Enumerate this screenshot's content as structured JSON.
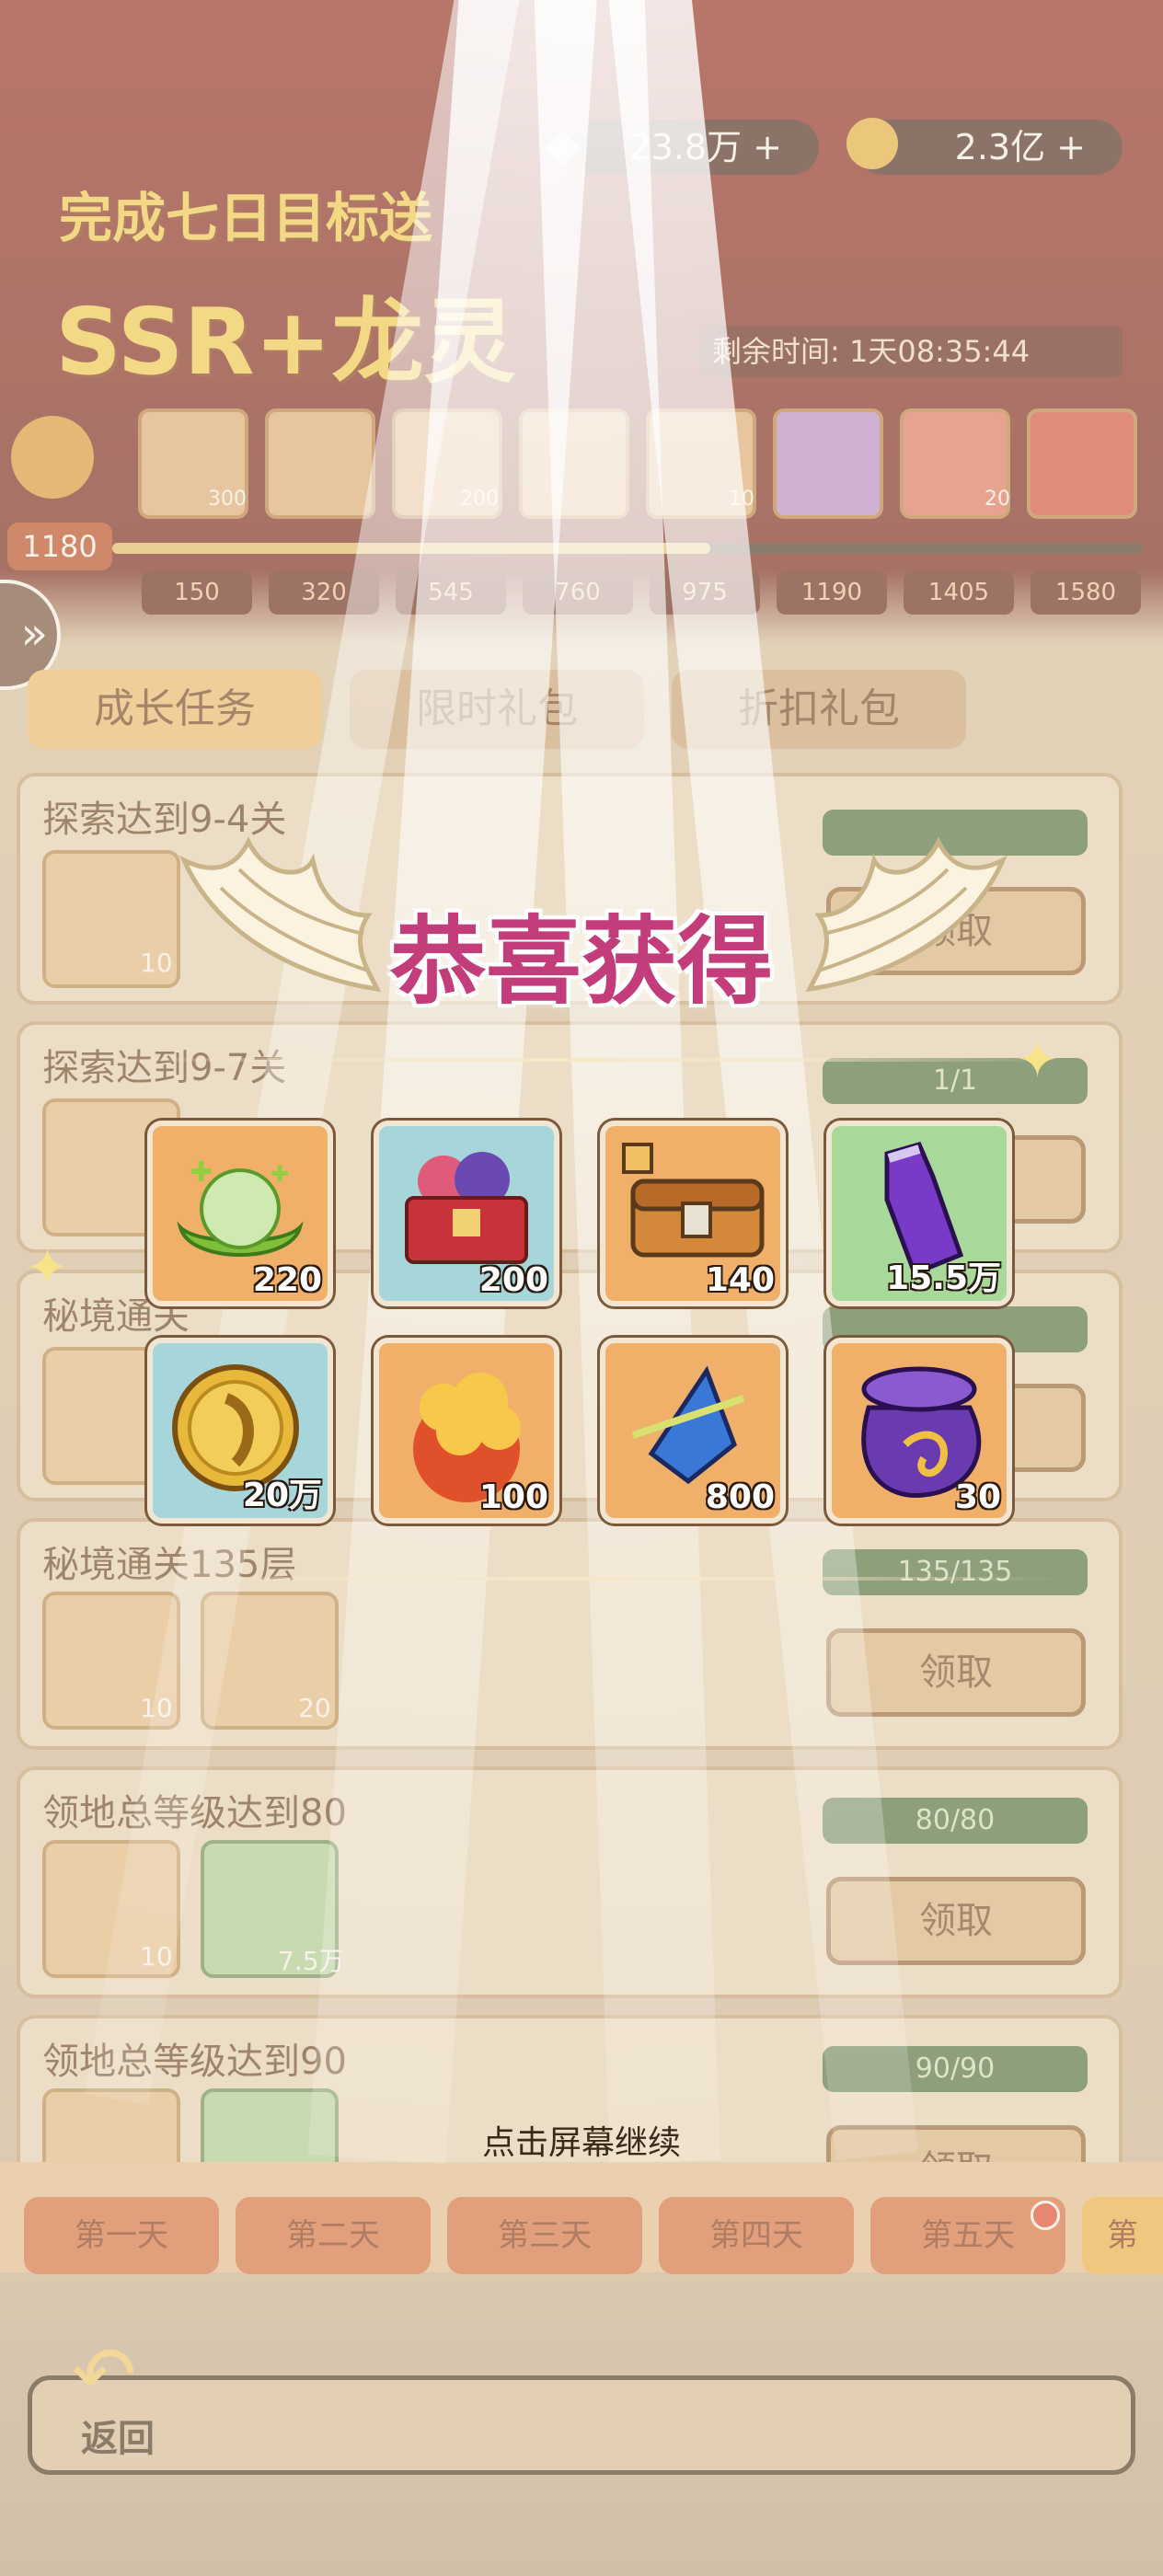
{
  "resources": {
    "gems": "23.8万",
    "coins": "2.3亿"
  },
  "event": {
    "title_line1": "完成七日目标送",
    "title_line2": "SSR+龙灵",
    "remaining_time_label": "剩余时间:",
    "remaining_time_value": "1天08:35:44",
    "points": "1180",
    "milestones": [
      "150",
      "320",
      "545",
      "760",
      "975",
      "1190",
      "1405",
      "1580"
    ],
    "milestone_counts": [
      "300",
      "",
      "200",
      "",
      "10",
      "",
      "20",
      ""
    ]
  },
  "tabs": [
    "成长任务",
    "限时礼包",
    "折扣礼包"
  ],
  "tasks": [
    {
      "title": "探索达到9-4关",
      "items": [
        "10"
      ],
      "progress": "",
      "button": "领取"
    },
    {
      "title": "探索达到9-7关",
      "items": [],
      "progress": "1/1",
      "button": ""
    },
    {
      "title": "秘境通关",
      "items": [],
      "progress": "",
      "button": ""
    },
    {
      "title": "秘境通关135层",
      "items": [
        "10",
        "20"
      ],
      "progress": "135/135",
      "button": "领取"
    },
    {
      "title": "领地总等级达到80",
      "items": [
        "10",
        "7.5万"
      ],
      "progress": "80/80",
      "button": "领取"
    },
    {
      "title": "领地总等级达到90",
      "items": [],
      "progress": "90/90",
      "button": "领取"
    }
  ],
  "days": [
    "第一天",
    "第二天",
    "第三天",
    "第四天",
    "第五天",
    "第"
  ],
  "back_label": "返回",
  "popup": {
    "title": "恭喜获得",
    "rewards": [
      {
        "icon": "green-egg-icon",
        "qty": "220",
        "bg": "orange"
      },
      {
        "icon": "gift-chest-icon",
        "qty": "200",
        "bg": "blue"
      },
      {
        "icon": "treasure-chest-icon",
        "qty": "140",
        "bg": "orange"
      },
      {
        "icon": "purple-potion-icon",
        "qty": "15.5万",
        "bg": "green"
      },
      {
        "icon": "gold-coin-icon",
        "qty": "20万",
        "bg": "blue"
      },
      {
        "icon": "fire-orb-icon",
        "qty": "100",
        "bg": "orange"
      },
      {
        "icon": "blue-crystal-icon",
        "qty": "800",
        "bg": "orange"
      },
      {
        "icon": "dragon-bag-icon",
        "qty": "30",
        "bg": "orange"
      }
    ],
    "continue_hint": "点击屏幕继续"
  }
}
